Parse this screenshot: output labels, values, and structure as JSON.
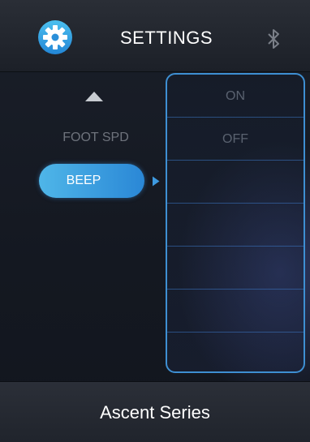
{
  "header": {
    "title": "SETTINGS",
    "settings_icon": "gear-icon",
    "status_icon": "bluetooth-icon"
  },
  "menu": {
    "scroll_up_icon": "triangle-up-icon",
    "items": [
      {
        "label": "FOOT SPD",
        "selected": false
      },
      {
        "label": "BEEP",
        "selected": true
      }
    ],
    "selection_indicator_icon": "triangle-right-icon"
  },
  "options": {
    "items": [
      "ON",
      "OFF",
      "",
      "",
      "",
      "",
      ""
    ]
  },
  "footer": {
    "label": "Ascent Series"
  },
  "colors": {
    "accent": "#3e8fd2",
    "selected_gradient_start": "#4fb6e8",
    "selected_gradient_end": "#2a87d6",
    "muted_text": "#5a6270"
  }
}
